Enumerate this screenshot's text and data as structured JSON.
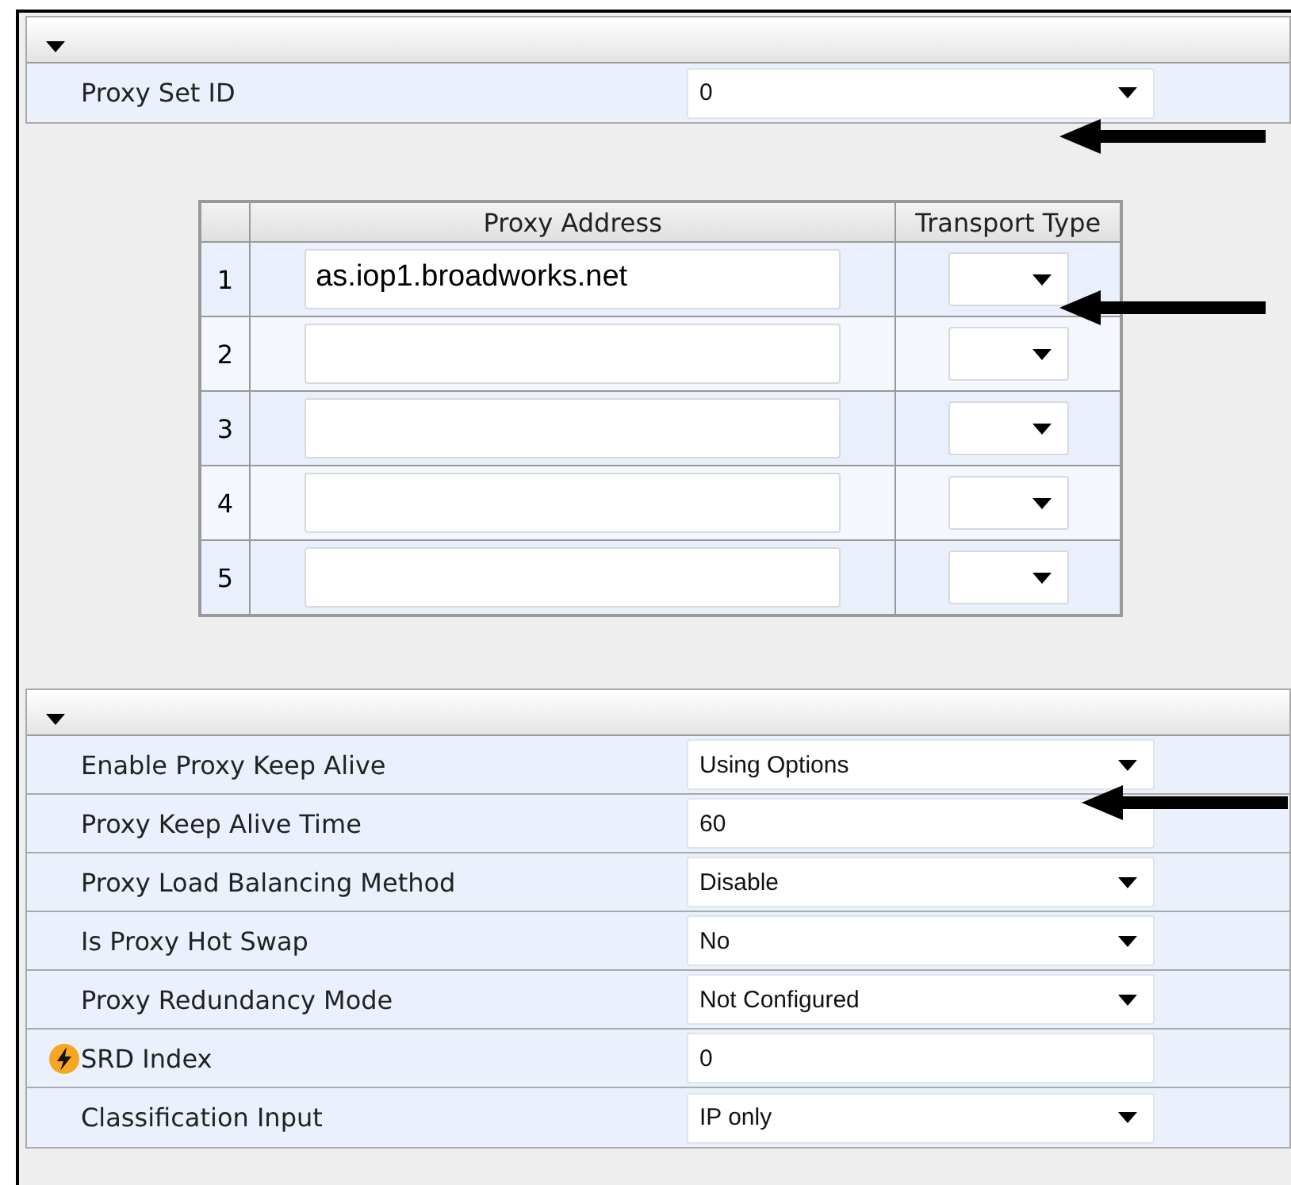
{
  "top_section": {
    "expanded": true,
    "rows": [
      {
        "label": "Proxy Set ID",
        "kind": "select",
        "value": "0"
      }
    ]
  },
  "proxy_table": {
    "columns": [
      "Proxy Address",
      "Transport Type"
    ],
    "rows": [
      {
        "index": "1",
        "address": "as.iop1.broadworks.net"
      },
      {
        "index": "2"
      },
      {
        "index": "3"
      },
      {
        "index": "4"
      },
      {
        "index": "5"
      }
    ]
  },
  "bottom_section": {
    "expanded": true,
    "rows": [
      {
        "label": "Enable Proxy Keep Alive",
        "kind": "select",
        "value": "Using Options"
      },
      {
        "label": "Proxy Keep Alive Time",
        "kind": "input",
        "value": "60"
      },
      {
        "label": "Proxy Load Balancing Method",
        "kind": "select",
        "value": "Disable"
      },
      {
        "label": "Is Proxy Hot Swap",
        "kind": "select",
        "value": "No"
      },
      {
        "label": "Proxy Redundancy Mode",
        "kind": "select",
        "value": "Not Configured"
      },
      {
        "label": "SRD Index",
        "kind": "input",
        "value": "0",
        "flag": true
      },
      {
        "label": "Classification Input",
        "kind": "select",
        "value": "IP only"
      }
    ]
  }
}
